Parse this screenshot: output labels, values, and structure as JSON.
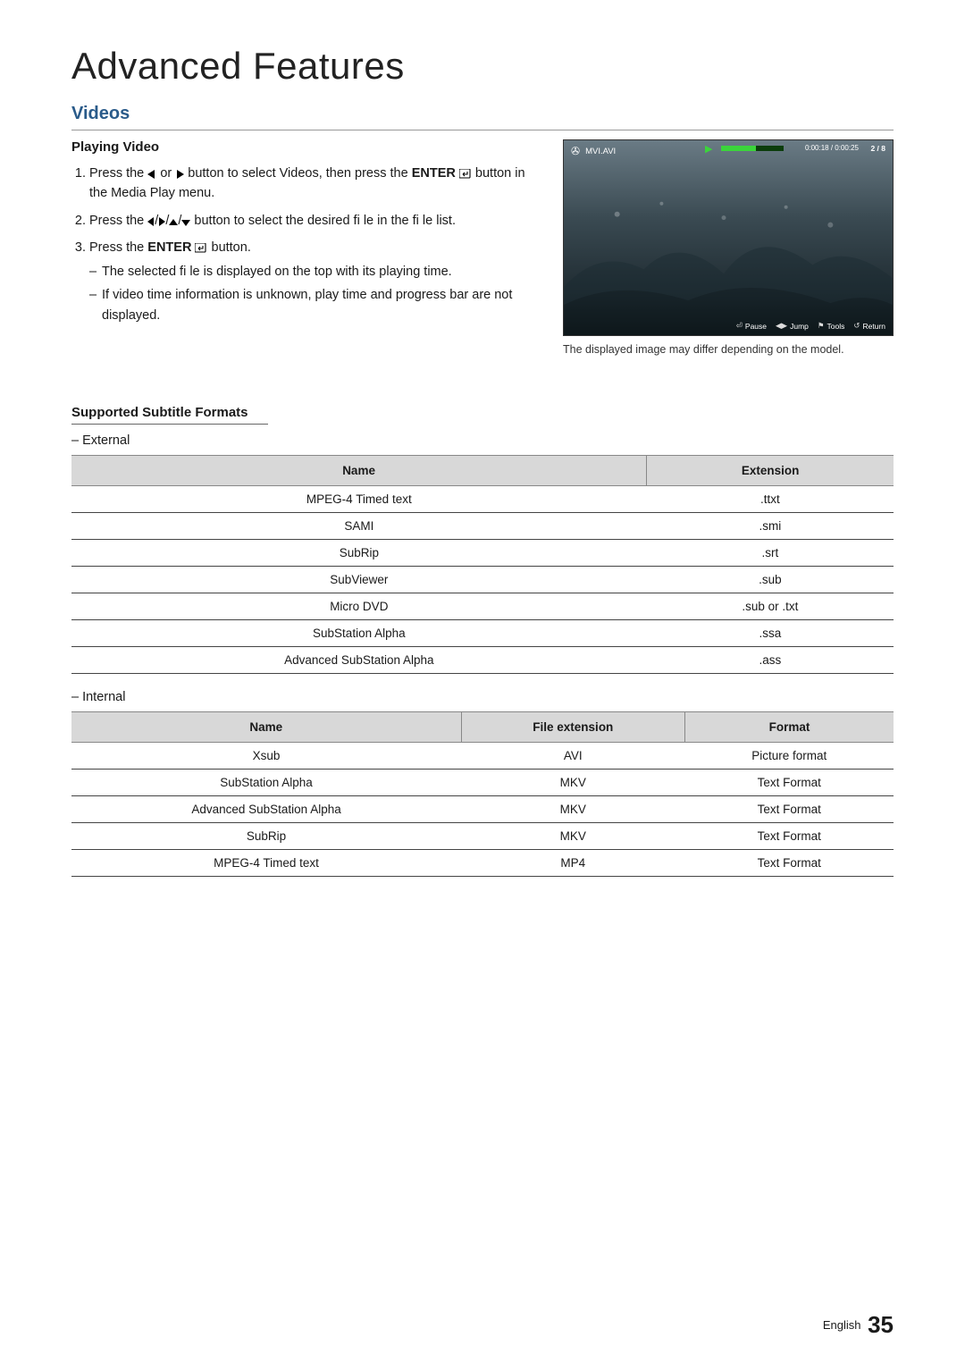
{
  "header": {
    "title": "Advanced Features"
  },
  "section": {
    "title": "Videos"
  },
  "playing": {
    "heading": "Playing Video",
    "step1_preA": "Press the ",
    "step1_preB": " or ",
    "step1_postA": " button to select Videos, then press the ",
    "step1_enter": "ENTER",
    "step1_tail": " button in the Media Play menu.",
    "step2_pre": "Press the ",
    "step2_post": " button to select the desired fi le in the fi le list.",
    "step3_pre": "Press the ",
    "step3_word": "ENTER",
    "step3_post": " button.",
    "bullet1": "The selected fi le is displayed on the top with its playing time.",
    "bullet2": "If video time information is unknown, play time and progress bar are not displayed."
  },
  "video": {
    "filename": "MVI.AVI",
    "timecode": "0:00:18 / 0:00:25",
    "counter": "2 / 8",
    "botbar": {
      "pause": "Pause",
      "jump": "Jump",
      "tools": "Tools",
      "return": "Return"
    },
    "caption": "The displayed image may differ depending on the model."
  },
  "subtitle_section": {
    "heading": "Supported Subtitle Formats",
    "external_label": "External",
    "internal_label": "Internal"
  },
  "external_table": {
    "headers": {
      "name": "Name",
      "ext": "Extension"
    },
    "rows": [
      {
        "name": "MPEG-4 Timed text",
        "ext": ".ttxt"
      },
      {
        "name": "SAMI",
        "ext": ".smi"
      },
      {
        "name": "SubRip",
        "ext": ".srt"
      },
      {
        "name": "SubViewer",
        "ext": ".sub"
      },
      {
        "name": "Micro DVD",
        "ext": ".sub or .txt"
      },
      {
        "name": "SubStation Alpha",
        "ext": ".ssa"
      },
      {
        "name": "Advanced SubStation Alpha",
        "ext": ".ass"
      }
    ]
  },
  "internal_table": {
    "headers": {
      "name": "Name",
      "fext": "File extension",
      "fmt": "Format"
    },
    "rows": [
      {
        "name": "Xsub",
        "fext": "AVI",
        "fmt": "Picture format"
      },
      {
        "name": "SubStation Alpha",
        "fext": "MKV",
        "fmt": "Text Format"
      },
      {
        "name": "Advanced SubStation Alpha",
        "fext": "MKV",
        "fmt": "Text Format"
      },
      {
        "name": "SubRip",
        "fext": "MKV",
        "fmt": "Text Format"
      },
      {
        "name": "MPEG-4 Timed text",
        "fext": "MP4",
        "fmt": "Text Format"
      }
    ]
  },
  "footer": {
    "lang": "English",
    "page": "35"
  }
}
